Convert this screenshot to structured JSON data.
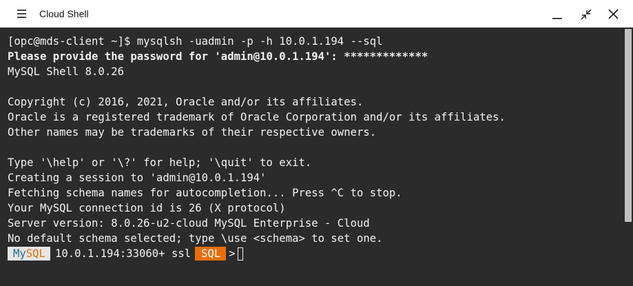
{
  "window": {
    "title": "Cloud Shell"
  },
  "terminal": {
    "lines": [
      {
        "text": "[opc@mds-client ~]$ mysqlsh -uadmin -p -h 10.0.1.194 --sql",
        "bold": false
      },
      {
        "text": "Please provide the password for 'admin@10.0.1.194': *************",
        "bold": true
      },
      {
        "text": "MySQL Shell 8.0.26",
        "bold": false
      },
      {
        "text": "",
        "bold": false
      },
      {
        "text": "Copyright (c) 2016, 2021, Oracle and/or its affiliates.",
        "bold": false
      },
      {
        "text": "Oracle is a registered trademark of Oracle Corporation and/or its affiliates.",
        "bold": false
      },
      {
        "text": "Other names may be trademarks of their respective owners.",
        "bold": false
      },
      {
        "text": "",
        "bold": false
      },
      {
        "text": "Type '\\help' or '\\?' for help; '\\quit' to exit.",
        "bold": false
      },
      {
        "text": "Creating a session to 'admin@10.0.1.194'",
        "bold": false
      },
      {
        "text": "Fetching schema names for autocompletion... Press ^C to stop.",
        "bold": false
      },
      {
        "text": "Your MySQL connection id is 26 (X protocol)",
        "bold": false
      },
      {
        "text": "Server version: 8.0.26-u2-cloud MySQL Enterprise - Cloud",
        "bold": false
      },
      {
        "text": "No default schema selected; type \\use <schema> to set one.",
        "bold": false
      }
    ],
    "prompt": {
      "mysql_my": "My",
      "mysql_sql": "SQL",
      "host": "10.0.1.194:33060+ ssl",
      "mode": "SQL",
      "arrow": ">"
    }
  },
  "icons": {
    "menu": "hamburger-menu-icon",
    "minimize": "minimize-icon",
    "restore": "restore-icon",
    "close": "close-icon"
  },
  "colors": {
    "terminal_bg": "#2b2b2b",
    "terminal_fg": "#f2f2f2",
    "prompt_mysql_bg": "#e6e6e6",
    "prompt_my": "#1e6f8f",
    "prompt_sql_accent": "#e76e0c"
  }
}
